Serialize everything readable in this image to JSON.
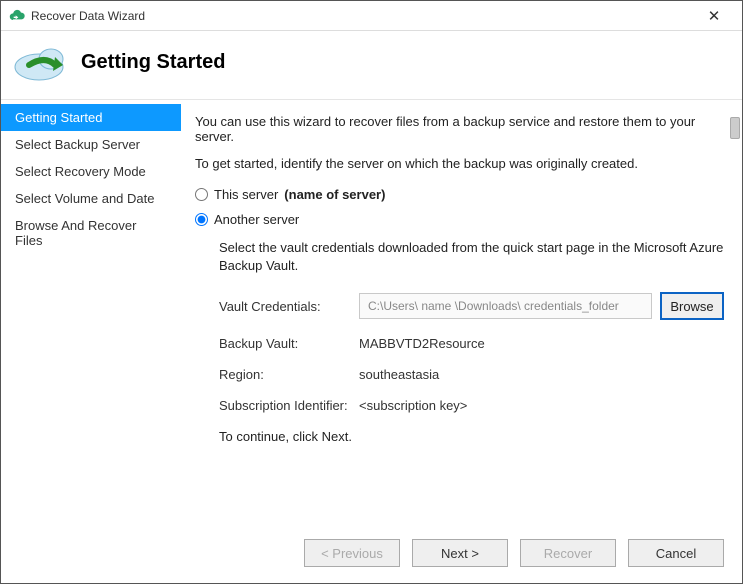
{
  "window": {
    "title": "Recover Data Wizard"
  },
  "header": {
    "pageTitle": "Getting Started"
  },
  "sidebar": {
    "items": [
      {
        "label": "Getting Started",
        "selected": true
      },
      {
        "label": "Select Backup Server",
        "selected": false
      },
      {
        "label": "Select Recovery Mode",
        "selected": false
      },
      {
        "label": "Select Volume and Date",
        "selected": false
      },
      {
        "label": "Browse And Recover Files",
        "selected": false
      }
    ]
  },
  "content": {
    "intro": "You can use this wizard to recover files from a backup service and restore them to your server.",
    "identify": "To get started, identify the server on which the backup was originally created.",
    "radioThis": {
      "label": "This server",
      "extra": "(name of server)",
      "checked": false
    },
    "radioAnother": {
      "label": "Another server",
      "checked": true
    },
    "vaultHint": "Select the vault credentials downloaded from the quick start page in the Microsoft Azure Backup Vault.",
    "vaultCredLabel": "Vault Credentials:",
    "vaultCredValue": "C:\\Users\\ name \\Downloads\\ credentials_folder",
    "browse": "Browse",
    "backupVaultLabel": "Backup Vault:",
    "backupVaultValue": "MABBVTD2Resource",
    "regionLabel": "Region:",
    "regionValue": "southeastasia",
    "subIdLabel": "Subscription Identifier:",
    "subIdValue": "<subscription key>",
    "continueHint": "To continue, click Next."
  },
  "footer": {
    "previous": "< Previous",
    "next": "Next >",
    "recover": "Recover",
    "cancel": "Cancel"
  }
}
